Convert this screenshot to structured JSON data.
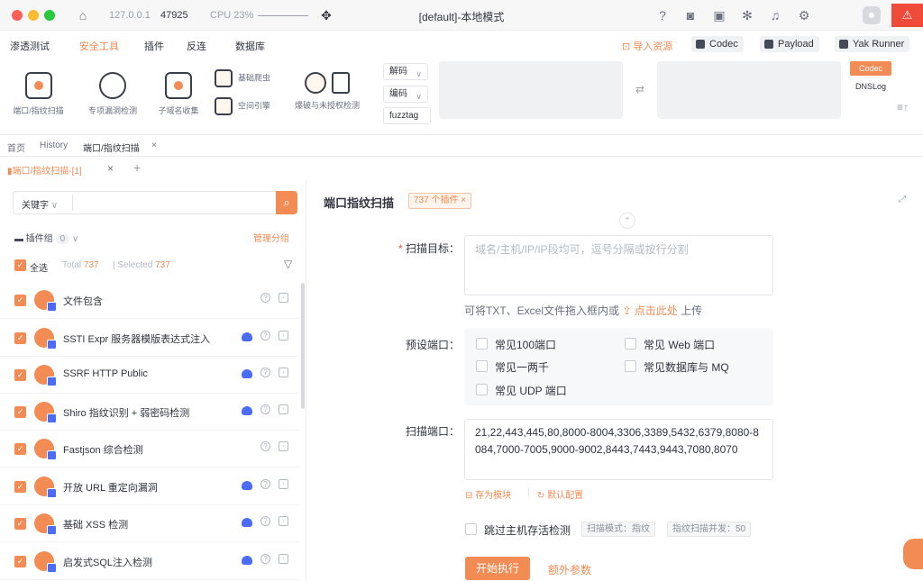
{
  "titlebar": {
    "host": "127.0.0.1",
    "port": "47925",
    "cpu": "CPU 23%",
    "title": "[default]-本地模式"
  },
  "menu": {
    "items": [
      "渗透测试",
      "安全工具",
      "插件",
      "反连",
      "数据库"
    ],
    "active_index": 1,
    "import_label": "导入资源",
    "codec_label": "Codec",
    "payload_label": "Payload",
    "runner_label": "Yak Runner"
  },
  "toolbar": {
    "tools": [
      "端口/指纹扫描",
      "专项漏洞检测",
      "子域名收集"
    ],
    "small_tools": [
      "基础爬虫",
      "空间引擎"
    ],
    "crack_label": "爆破与未授权检测",
    "decode_label": "解码",
    "encode_label": "编码",
    "fuzztag_label": "fuzztag",
    "codec_tag": "Codec",
    "dnslog_tag": "DNSLog"
  },
  "tabs": {
    "top": [
      "首页",
      "History",
      "端口/指纹扫描"
    ],
    "sub": "端口/指纹扫描-[1]"
  },
  "left": {
    "search_type": "关键字",
    "group_label": "插件组",
    "group_count": "0",
    "manage_label": "管理分组",
    "select_all": "全选",
    "total_label": "Total",
    "total": "737",
    "selected_label": "Selected",
    "selected": "737",
    "plugins": [
      {
        "name": "文件包含",
        "cloud": false
      },
      {
        "name": "SSTI Expr 服务器模版表达式注入",
        "cloud": true
      },
      {
        "name": "SSRF HTTP Public",
        "cloud": true
      },
      {
        "name": "Shiro 指纹识别 + 弱密码检测",
        "cloud": true
      },
      {
        "name": "Fastjson 综合检测",
        "cloud": false
      },
      {
        "name": "开放 URL 重定向漏洞",
        "cloud": true
      },
      {
        "name": "基础 XSS 检测",
        "cloud": true
      },
      {
        "name": "启发式SQL注入检测",
        "cloud": true
      }
    ]
  },
  "right": {
    "title": "端口指纹扫描",
    "plugin_tag": "737 个插件",
    "target_label": "扫描目标：",
    "target_placeholder": "域名/主机/IP/IP段均可，逗号分隔或按行分割",
    "upload_hint": "可将TXT、Excel文件拖入框内或",
    "upload_link": "点击此处",
    "upload_tail": "上传",
    "preset_label": "预设端口：",
    "presets": [
      "常见100端口",
      "常见 Web 端口",
      "常见一两千",
      "常见数据库与 MQ",
      "常见 UDP 端口"
    ],
    "ports_label": "扫描端口：",
    "ports_value": "21,22,443,445,80,8000-8004,3306,3389,5432,6379,8080-8084,7000-7005,9000-9002,8443,7443,9443,7080,8070",
    "save_template": "存为模块",
    "default_config": "默认配置",
    "skip_alive": "跳过主机存活检测",
    "scan_mode": "扫描模式：指纹",
    "concurrency": "指纹扫描并发：50",
    "start_label": "开始执行",
    "extra_label": "额外参数"
  },
  "colors": {
    "accent": "#f28b54",
    "blue": "#4a6cf7"
  }
}
